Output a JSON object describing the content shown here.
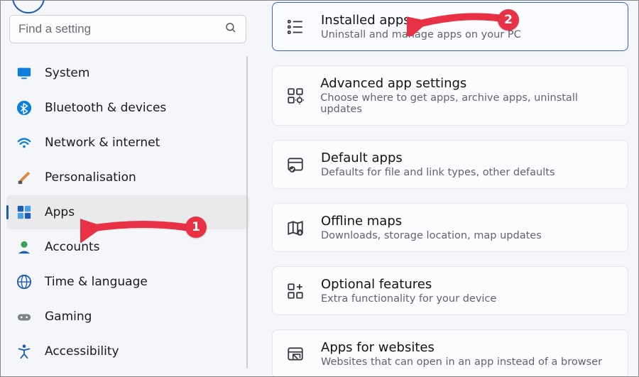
{
  "search": {
    "placeholder": "Find a setting"
  },
  "sidebar": {
    "items": [
      {
        "label": "System"
      },
      {
        "label": "Bluetooth & devices"
      },
      {
        "label": "Network & internet"
      },
      {
        "label": "Personalisation"
      },
      {
        "label": "Apps"
      },
      {
        "label": "Accounts"
      },
      {
        "label": "Time & language"
      },
      {
        "label": "Gaming"
      },
      {
        "label": "Accessibility"
      }
    ]
  },
  "cards": [
    {
      "title": "Installed apps",
      "sub": "Uninstall and manage apps on your PC"
    },
    {
      "title": "Advanced app settings",
      "sub": "Choose where to get apps, archive apps, uninstall updates"
    },
    {
      "title": "Default apps",
      "sub": "Defaults for file and link types, other defaults"
    },
    {
      "title": "Offline maps",
      "sub": "Downloads, storage location, map updates"
    },
    {
      "title": "Optional features",
      "sub": "Extra functionality for your device"
    },
    {
      "title": "Apps for websites",
      "sub": "Websites that can open in an app instead of a browser"
    }
  ],
  "annotations": {
    "badge1": "1",
    "badge2": "2"
  }
}
